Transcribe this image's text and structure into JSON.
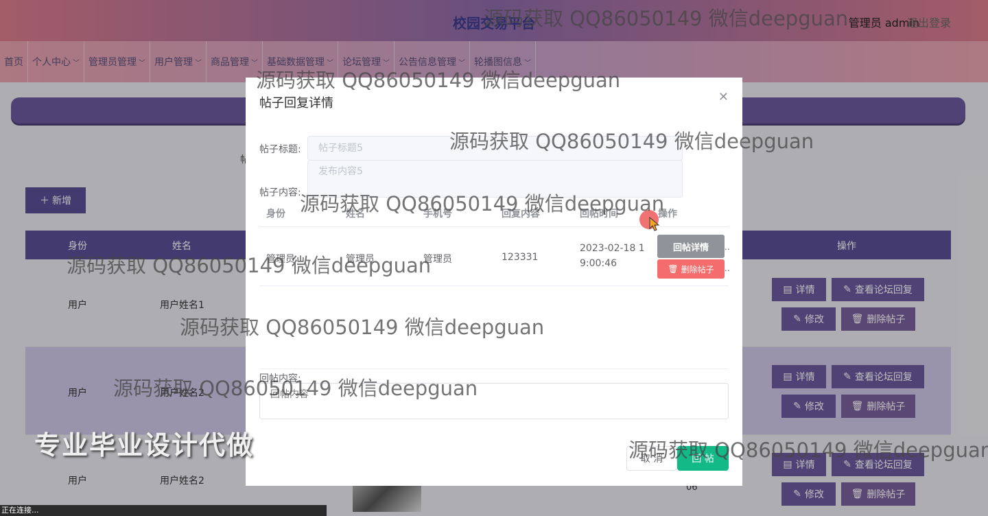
{
  "header": {
    "site_title": "校园交易平台",
    "user_info": "管理员 admin",
    "logout_label": "退出登录"
  },
  "nav": {
    "items": [
      {
        "label": "首页",
        "caret": false
      },
      {
        "label": "个人中心",
        "caret": true
      },
      {
        "label": "管理员管理",
        "caret": true
      },
      {
        "label": "用户管理",
        "caret": true
      },
      {
        "label": "商品管理",
        "caret": true
      },
      {
        "label": "基础数据管理",
        "caret": true
      },
      {
        "label": "论坛管理",
        "caret": true
      },
      {
        "label": "公告信息管理",
        "caret": true
      },
      {
        "label": "轮播图信息",
        "caret": true
      }
    ]
  },
  "page": {
    "truncated_label": "帖",
    "add_button": "新增",
    "table_headers": {
      "identity": "身份",
      "name": "姓名",
      "actions": "操作"
    },
    "rows": [
      {
        "identity": "用户",
        "name": "用户姓名1"
      },
      {
        "identity": "用户",
        "name": "用户姓名2"
      },
      {
        "identity": "用户",
        "name": "用户姓名2"
      }
    ],
    "row_actions": {
      "detail": "详情",
      "view_replies": "查看论坛回复",
      "edit": "修改",
      "delete": "删除帖子"
    },
    "row_tail": "06"
  },
  "dialog": {
    "title": "帖子回复详情",
    "post_title_label": "帖子标题:",
    "post_title_value": "帖子标题5",
    "post_content_label": "帖子内容:",
    "post_content_value": "发布内容5",
    "table_headers": {
      "identity": "身份",
      "name": "姓名",
      "phone": "手机号",
      "reply_content": "回复内容",
      "reply_time": "回帖时间",
      "actions": "操作"
    },
    "reply_row": {
      "identity": "管理员",
      "name": "管理员",
      "phone": "管理员",
      "content": "123331",
      "time_line1": "2023-02-18 1",
      "time_line2": "9:00:46"
    },
    "reply_detail_button": "回帖详情",
    "delete_post_button": "删除帖子",
    "reply_label": "回帖内容:",
    "reply_placeholder": "回帖内容",
    "cancel_button": "取 消",
    "submit_button": "回 帖"
  },
  "overlay": {
    "banner": "专业毕业设计代做",
    "status_bar": "正在连接...",
    "watermark": "源码获取 QQ86050149 微信deepguan"
  },
  "colors": {
    "accent": "#5a4f95",
    "success": "#13b986",
    "danger": "#f56c6c",
    "info": "#909399"
  }
}
